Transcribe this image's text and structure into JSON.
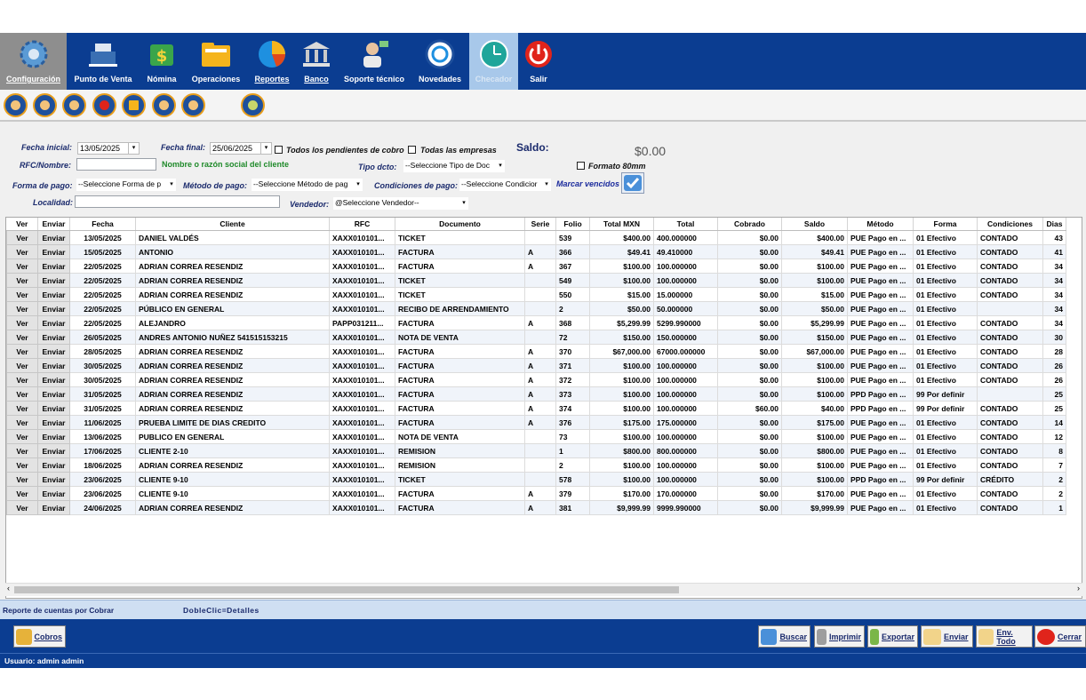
{
  "ribbon": {
    "items": [
      {
        "label": "Configuración",
        "icon": "gear-icon",
        "color": "#2f78c4"
      },
      {
        "label": "Punto de Venta",
        "icon": "cash-register-icon",
        "color": "#3a6fb3"
      },
      {
        "label": "Nómina",
        "icon": "payroll-icon",
        "color": "#3aa54a"
      },
      {
        "label": "Operaciones",
        "icon": "folder-icon",
        "color": "#f5b41c"
      },
      {
        "label": "Reportes",
        "icon": "pie-chart-icon",
        "color": "#1e90e0"
      },
      {
        "label": "Banco",
        "icon": "bank-icon",
        "color": "#c9c9c9"
      },
      {
        "label": "Soporte técnico",
        "icon": "support-agent-icon",
        "color": "#e8c39e"
      },
      {
        "label": "Novedades",
        "icon": "news-globe-icon",
        "color": "#ffffff"
      },
      {
        "label": "Checador",
        "icon": "clock-icon",
        "color": "#1fa59a"
      },
      {
        "label": "Salir",
        "icon": "power-icon",
        "color": "#e0241b"
      }
    ]
  },
  "subicons": [
    "customers-icon",
    "suppliers-icon",
    "notes-icon",
    "shopping-bag-icon",
    "bar-chart-icon",
    "employee-icon",
    "employee-alt-icon",
    "award-icon"
  ],
  "filters": {
    "fecha_inicial_label": "Fecha inicial:",
    "fecha_inicial": "13/05/2025",
    "fecha_final_label": "Fecha final:",
    "fecha_final": "25/06/2025",
    "pendientes_label": "Todos los pendientes de cobro",
    "empresas_label": "Todas las empresas",
    "saldo_label": "Saldo:",
    "saldo_value": "$0.00",
    "rfc_label": "RFC/Nombre:",
    "rfc_hint": "Nombre o razón social del cliente",
    "tipo_label": "Tipo dcto:",
    "tipo_value": "--Seleccione Tipo de Doc",
    "formato_label": "Formato 80mm",
    "forma_label": "Forma de pago:",
    "forma_value": "--Seleccione Forma de p",
    "metodo_label": "Método de pago:",
    "metodo_value": "--Seleccione Método de pag",
    "condiciones_label": "Condiciones de pago:",
    "condiciones_value": "--Seleccione Condicior",
    "vencidos_label": "Marcar vencidos",
    "localidad_label": "Localidad:",
    "vendedor_label": "Vendedor:",
    "vendedor_value": "@Seleccione Vendedor--"
  },
  "table": {
    "headers": [
      "Ver",
      "Enviar",
      "Fecha",
      "Cliente",
      "RFC",
      "Documento",
      "Serie",
      "Folio",
      "Total MXN",
      "Total",
      "Cobrado",
      "Saldo",
      "Método",
      "Forma",
      "Condiciones",
      "Dias"
    ],
    "ver_label": "Ver",
    "enviar_label": "Enviar",
    "rows": [
      [
        "13/05/2025",
        "DANIEL VALDÉS",
        "XAXX010101...",
        "TICKET",
        "",
        "539",
        "$400.00",
        "400.000000",
        "$0.00",
        "$400.00",
        "PUE Pago en ...",
        "01 Efectivo",
        "CONTADO",
        "43"
      ],
      [
        "15/05/2025",
        "ANTONIO",
        "XAXX010101...",
        "FACTURA",
        "A",
        "366",
        "$49.41",
        "49.410000",
        "$0.00",
        "$49.41",
        "PUE Pago en ...",
        "01 Efectivo",
        "CONTADO",
        "41"
      ],
      [
        "22/05/2025",
        "ADRIAN CORREA RESENDIZ",
        "XAXX010101...",
        "FACTURA",
        "A",
        "367",
        "$100.00",
        "100.000000",
        "$0.00",
        "$100.00",
        "PUE Pago en ...",
        "01 Efectivo",
        "CONTADO",
        "34"
      ],
      [
        "22/05/2025",
        "ADRIAN CORREA RESENDIZ",
        "XAXX010101...",
        "TICKET",
        "",
        "549",
        "$100.00",
        "100.000000",
        "$0.00",
        "$100.00",
        "PUE Pago en ...",
        "01 Efectivo",
        "CONTADO",
        "34"
      ],
      [
        "22/05/2025",
        "ADRIAN CORREA RESENDIZ",
        "XAXX010101...",
        "TICKET",
        "",
        "550",
        "$15.00",
        "15.000000",
        "$0.00",
        "$15.00",
        "PUE Pago en ...",
        "01 Efectivo",
        "CONTADO",
        "34"
      ],
      [
        "22/05/2025",
        "PÚBLICO EN GENERAL",
        "XAXX010101...",
        "RECIBO DE ARRENDAMIENTO",
        "",
        "2",
        "$50.00",
        "50.000000",
        "$0.00",
        "$50.00",
        "PUE Pago en ...",
        "01 Efectivo",
        "",
        "34"
      ],
      [
        "22/05/2025",
        "ALEJANDRO",
        "PAPP031211...",
        "FACTURA",
        "A",
        "368",
        "$5,299.99",
        "5299.990000",
        "$0.00",
        "$5,299.99",
        "PUE Pago en ...",
        "01 Efectivo",
        "CONTADO",
        "34"
      ],
      [
        "26/05/2025",
        "ANDRES ANTONIO NUÑEZ 541515153215",
        "XAXX010101...",
        "NOTA DE VENTA",
        "",
        "72",
        "$150.00",
        "150.000000",
        "$0.00",
        "$150.00",
        "PUE Pago en ...",
        "01 Efectivo",
        "CONTADO",
        "30"
      ],
      [
        "28/05/2025",
        "ADRIAN CORREA RESENDIZ",
        "XAXX010101...",
        "FACTURA",
        "A",
        "370",
        "$67,000.00",
        "67000.000000",
        "$0.00",
        "$67,000.00",
        "PUE Pago en ...",
        "01 Efectivo",
        "CONTADO",
        "28"
      ],
      [
        "30/05/2025",
        "ADRIAN CORREA RESENDIZ",
        "XAXX010101...",
        "FACTURA",
        "A",
        "371",
        "$100.00",
        "100.000000",
        "$0.00",
        "$100.00",
        "PUE Pago en ...",
        "01 Efectivo",
        "CONTADO",
        "26"
      ],
      [
        "30/05/2025",
        "ADRIAN CORREA RESENDIZ",
        "XAXX010101...",
        "FACTURA",
        "A",
        "372",
        "$100.00",
        "100.000000",
        "$0.00",
        "$100.00",
        "PUE Pago en ...",
        "01 Efectivo",
        "CONTADO",
        "26"
      ],
      [
        "31/05/2025",
        "ADRIAN CORREA RESENDIZ",
        "XAXX010101...",
        "FACTURA",
        "A",
        "373",
        "$100.00",
        "100.000000",
        "$0.00",
        "$100.00",
        "PPD Pago en ...",
        "99 Por definir",
        "",
        "25"
      ],
      [
        "31/05/2025",
        "ADRIAN CORREA RESENDIZ",
        "XAXX010101...",
        "FACTURA",
        "A",
        "374",
        "$100.00",
        "100.000000",
        "$60.00",
        "$40.00",
        "PPD Pago en ...",
        "99 Por definir",
        "CONTADO",
        "25"
      ],
      [
        "11/06/2025",
        "PRUEBA LIMITE DE DIAS CREDITO",
        "XAXX010101...",
        "FACTURA",
        "A",
        "376",
        "$175.00",
        "175.000000",
        "$0.00",
        "$175.00",
        "PUE Pago en ...",
        "01 Efectivo",
        "CONTADO",
        "14"
      ],
      [
        "13/06/2025",
        "PUBLICO EN GENERAL",
        "XAXX010101...",
        "NOTA DE VENTA",
        "",
        "73",
        "$100.00",
        "100.000000",
        "$0.00",
        "$100.00",
        "PUE Pago en ...",
        "01 Efectivo",
        "CONTADO",
        "12"
      ],
      [
        "17/06/2025",
        "CLIENTE 2-10",
        "XAXX010101...",
        "REMISION",
        "",
        "1",
        "$800.00",
        "800.000000",
        "$0.00",
        "$800.00",
        "PUE Pago en ...",
        "01 Efectivo",
        "CONTADO",
        "8"
      ],
      [
        "18/06/2025",
        "ADRIAN CORREA RESENDIZ",
        "XAXX010101...",
        "REMISION",
        "",
        "2",
        "$100.00",
        "100.000000",
        "$0.00",
        "$100.00",
        "PUE Pago en ...",
        "01 Efectivo",
        "CONTADO",
        "7"
      ],
      [
        "23/06/2025",
        "CLIENTE 9-10",
        "XAXX010101...",
        "TICKET",
        "",
        "578",
        "$100.00",
        "100.000000",
        "$0.00",
        "$100.00",
        "PPD Pago en ...",
        "99 Por definir",
        "CRÉDITO",
        "2"
      ],
      [
        "23/06/2025",
        "CLIENTE 9-10",
        "XAXX010101...",
        "FACTURA",
        "A",
        "379",
        "$170.00",
        "170.000000",
        "$0.00",
        "$170.00",
        "PUE Pago en ...",
        "01 Efectivo",
        "CONTADO",
        "2"
      ],
      [
        "24/06/2025",
        "ADRIAN CORREA RESENDIZ",
        "XAXX010101...",
        "FACTURA",
        "A",
        "381",
        "$9,999.99",
        "9999.990000",
        "$0.00",
        "$9,999.99",
        "PUE Pago en ...",
        "01 Efectivo",
        "CONTADO",
        "1"
      ]
    ]
  },
  "infobar": {
    "report": "Reporte de cuentas por Cobrar",
    "hint": "DobleClic=Detalles"
  },
  "footer": {
    "cobros": "Cobros",
    "buscar": "Buscar",
    "imprimir": "Imprimir",
    "exportar": "Exportar",
    "enviar": "Enviar",
    "env_todo": "Env. Todo",
    "cerrar": "Cerrar"
  },
  "status": {
    "user": "Usuario: admin admin"
  },
  "colors": {
    "ribbon_bg": "#0b3d91",
    "label_color": "#1a2a6c",
    "hint_green": "#1f8a2a"
  }
}
